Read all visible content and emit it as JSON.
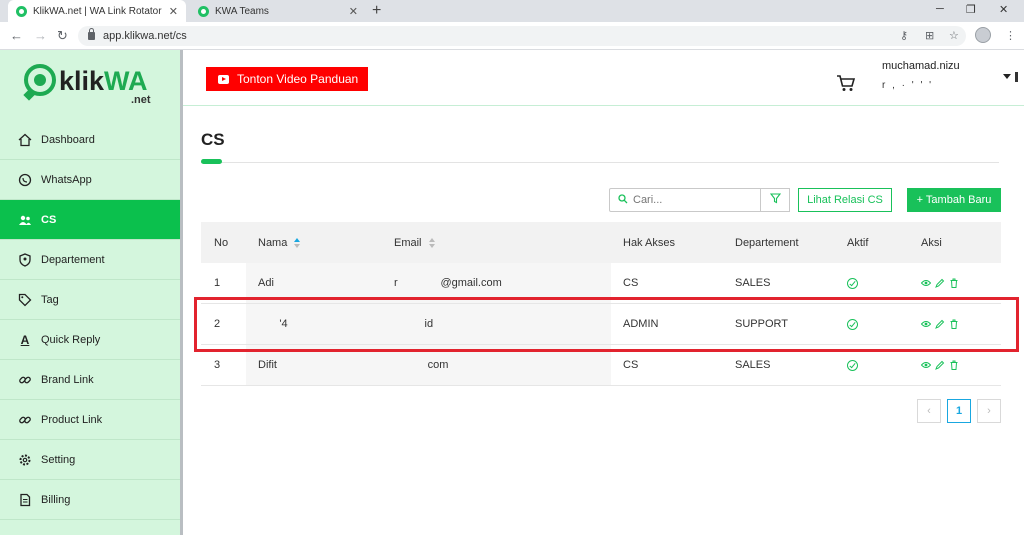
{
  "browser": {
    "tabs": [
      {
        "title": "KlikWA.net | WA Link Rotator",
        "close": "✕"
      },
      {
        "title": "KWA Teams",
        "close": "✕"
      }
    ],
    "new_tab": "+",
    "url": "app.klikwa.net/cs"
  },
  "logo": {
    "klik": "klik",
    "wa": "WA",
    "net": ".net"
  },
  "sidebar": {
    "items": [
      {
        "label": "Dashboard",
        "icon": "home-icon"
      },
      {
        "label": "WhatsApp",
        "icon": "whatsapp-icon"
      },
      {
        "label": "CS",
        "icon": "users-icon",
        "active": true
      },
      {
        "label": "Departement",
        "icon": "badge-icon"
      },
      {
        "label": "Tag",
        "icon": "tag-icon"
      },
      {
        "label": "Quick Reply",
        "icon": "font-icon"
      },
      {
        "label": "Brand Link",
        "icon": "link-icon"
      },
      {
        "label": "Product Link",
        "icon": "link-icon"
      },
      {
        "label": "Setting",
        "icon": "gear-icon"
      },
      {
        "label": "Billing",
        "icon": "document-icon"
      }
    ]
  },
  "header": {
    "video_button": "Tonton Video Panduan",
    "user_name": "muchamad.nizu",
    "user_sub": "r ,  · ' ' '"
  },
  "page": {
    "title": "CS"
  },
  "toolbar": {
    "search_placeholder": "Cari...",
    "relasi_button": "Lihat Relasi CS",
    "add_button": "+ Tambah Baru"
  },
  "table": {
    "columns": [
      "No",
      "Nama",
      "Email",
      "Hak Akses",
      "Departement",
      "Aktif",
      "Aksi"
    ],
    "rows": [
      {
        "no": "1",
        "nama": "  Adi",
        "email": "r              @gmail.com",
        "hak": "CS",
        "dep": "SALES"
      },
      {
        "no": "2",
        "nama": "       '4",
        "email": "          id",
        "hak": "ADMIN",
        "dep": "SUPPORT"
      },
      {
        "no": "3",
        "nama": "Difit",
        "email": "           com",
        "hak": "CS",
        "dep": "SALES"
      }
    ]
  },
  "pagination": {
    "prev": "‹",
    "current": "1",
    "next": "›"
  },
  "colors": {
    "accent": "#19c15a",
    "sidebar": "#d4f6dd",
    "highlight": "#e2232e",
    "youtube": "#ff0000"
  }
}
